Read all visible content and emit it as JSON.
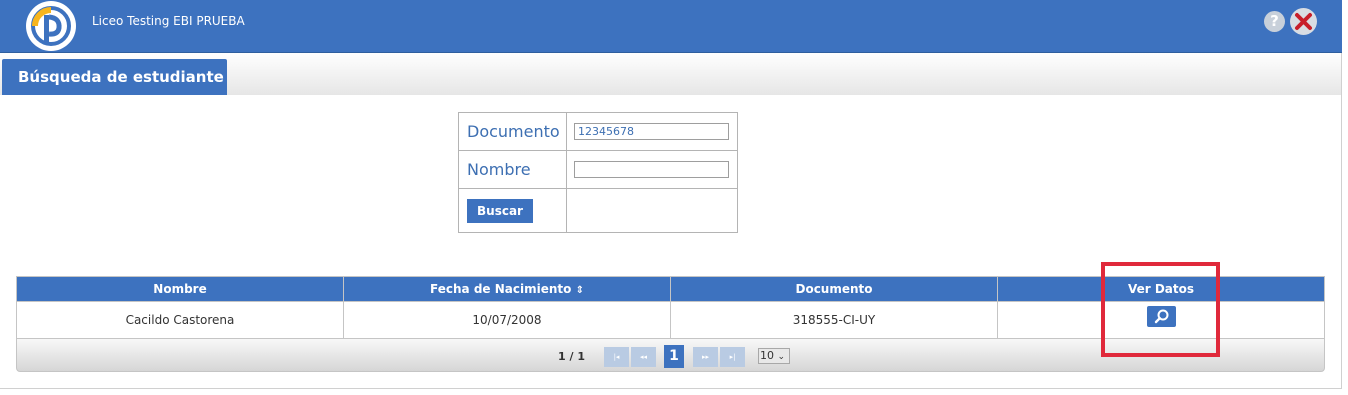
{
  "app": {
    "title": "Liceo Testing EBI PRUEBA"
  },
  "header": {
    "help_label": "?"
  },
  "tab": {
    "label": "Búsqueda de estudiante"
  },
  "search": {
    "documento_label": "Documento",
    "documento_value": "12345678",
    "nombre_label": "Nombre",
    "nombre_value": "",
    "button_label": "Buscar"
  },
  "table": {
    "columns": [
      "Nombre",
      "Fecha de Nacimiento",
      "Documento",
      "Ver Datos"
    ],
    "sort_indicator": "⇕",
    "rows": [
      {
        "nombre": "Cacildo Castorena",
        "fecha": "10/07/2008",
        "documento": "318555-CI-UY"
      }
    ]
  },
  "pager": {
    "status": "1 / 1",
    "first": "|◂",
    "prev": "◂◂",
    "current_page": "1",
    "next": "▸▸",
    "last": "▸|",
    "page_size": "10"
  },
  "colors": {
    "primary": "#3d72bf",
    "highlight": "#e0293b",
    "logo_yellow": "#f7b51d"
  },
  "icons": {
    "logo": "logo-icon",
    "help": "help-icon",
    "close": "close-icon",
    "view": "search-icon"
  }
}
